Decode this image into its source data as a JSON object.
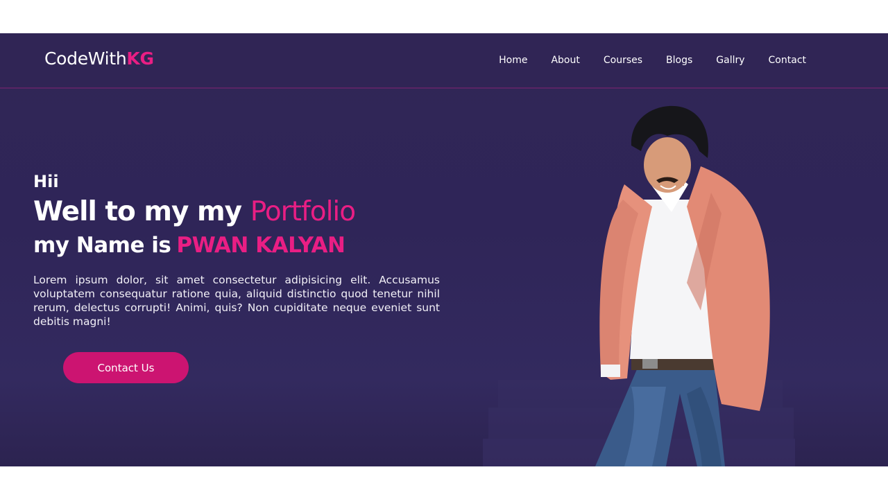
{
  "nav": {
    "logo_main": "CodeWith",
    "logo_accent": "KG",
    "links": [
      "Home",
      "About",
      "Courses",
      "Blogs",
      "Gallry",
      "Contact"
    ]
  },
  "hero": {
    "greeting": "Hii",
    "headline_main": "Well to my my",
    "headline_accent": "Portfolio",
    "name_prefix": "my Name is",
    "name": "PWAN KALYAN",
    "description": "Lorem ipsum dolor, sit amet consectetur adipisicing elit. Accusamus voluptatem consequatur ratione quia, aliquid distinctio quod tenetur nihil rerum, delectus corrupti! Animi, quis? Non cupiditate neque eveniet sunt debitis magni!",
    "cta_label": "Contact Us"
  },
  "colors": {
    "background": "#302656",
    "accent": "#e91e84",
    "button": "#cc1471",
    "text": "#ffffff"
  },
  "images": {
    "hero_photo": "person-standing-photo"
  }
}
